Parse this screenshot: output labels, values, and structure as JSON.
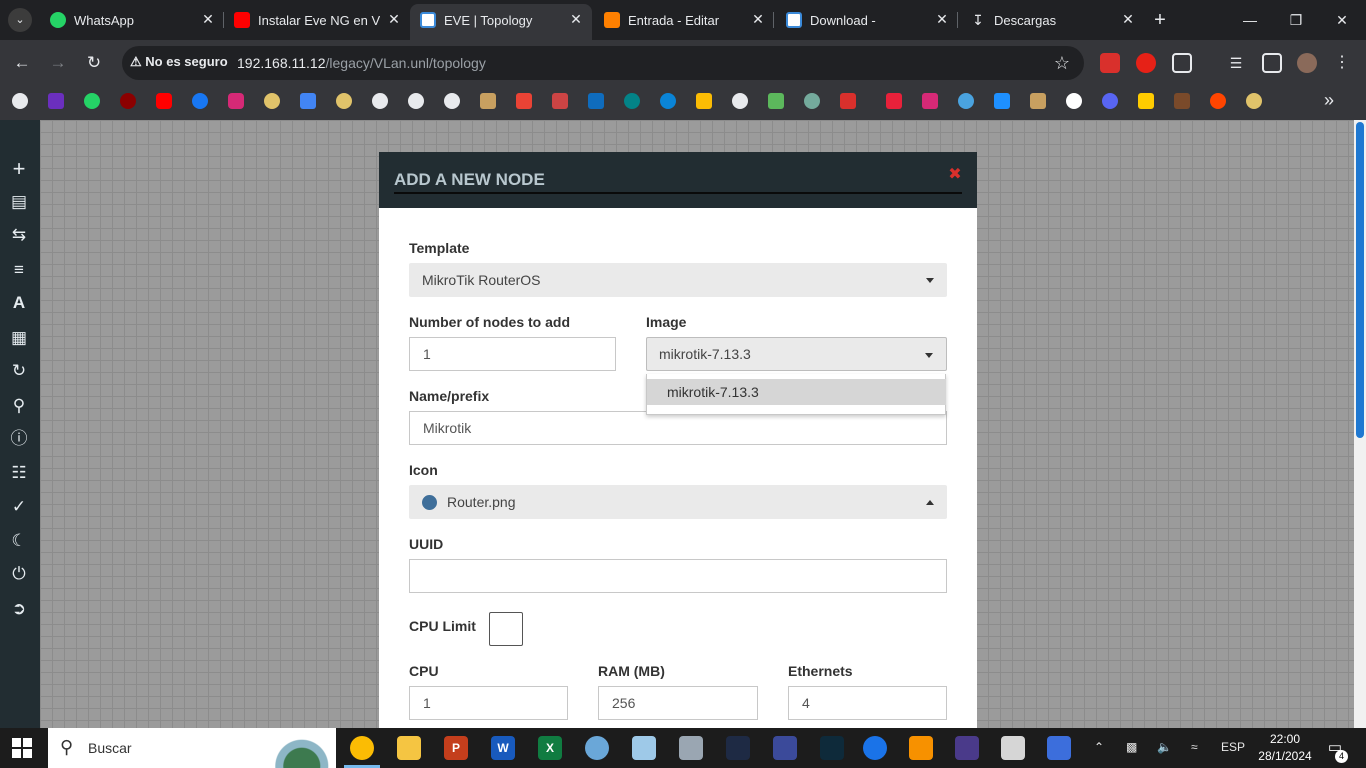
{
  "browser": {
    "tabs": [
      {
        "title": "WhatsApp",
        "favicon": "whatsapp-icon",
        "color": "#25d366"
      },
      {
        "title": "Instalar Eve NG en VMware",
        "favicon": "youtube-icon",
        "color": "#ff0000"
      },
      {
        "title": "EVE | Topology",
        "favicon": "eve-icon",
        "color": "#3b8ad9",
        "active": true
      },
      {
        "title": "Entrada - Editar",
        "favicon": "blogger-icon",
        "color": "#ff8000"
      },
      {
        "title": "Download -",
        "favicon": "eve-icon",
        "color": "#3b8ad9"
      },
      {
        "title": "Descargas",
        "favicon": "download-icon",
        "color": "#e8eaed"
      }
    ],
    "security_label": "No es seguro",
    "url_host": "192.168.11.12",
    "url_path": "/legacy/VLan.unl/topology"
  },
  "modal": {
    "title": "ADD A NEW NODE",
    "template_label": "Template",
    "template_value": "MikroTik RouterOS",
    "nodes_label": "Number of nodes to add",
    "nodes_value": "1",
    "image_label": "Image",
    "image_value": "mikrotik-7.13.3",
    "image_options": [
      "mikrotik-7.13.3"
    ],
    "name_label": "Name/prefix",
    "name_value": "Mikrotik",
    "icon_label": "Icon",
    "icon_value": "Router.png",
    "uuid_label": "UUID",
    "uuid_value": "",
    "cpu_limit_label": "CPU Limit",
    "cpu_label": "CPU",
    "cpu_value": "1",
    "ram_label": "RAM (MB)",
    "ram_value": "256",
    "ethernets_label": "Ethernets",
    "ethernets_value": "4"
  },
  "taskbar": {
    "search_label": "Buscar",
    "language": "ESP",
    "time": "22:00",
    "date": "28/1/2024",
    "notification_count": "4"
  }
}
